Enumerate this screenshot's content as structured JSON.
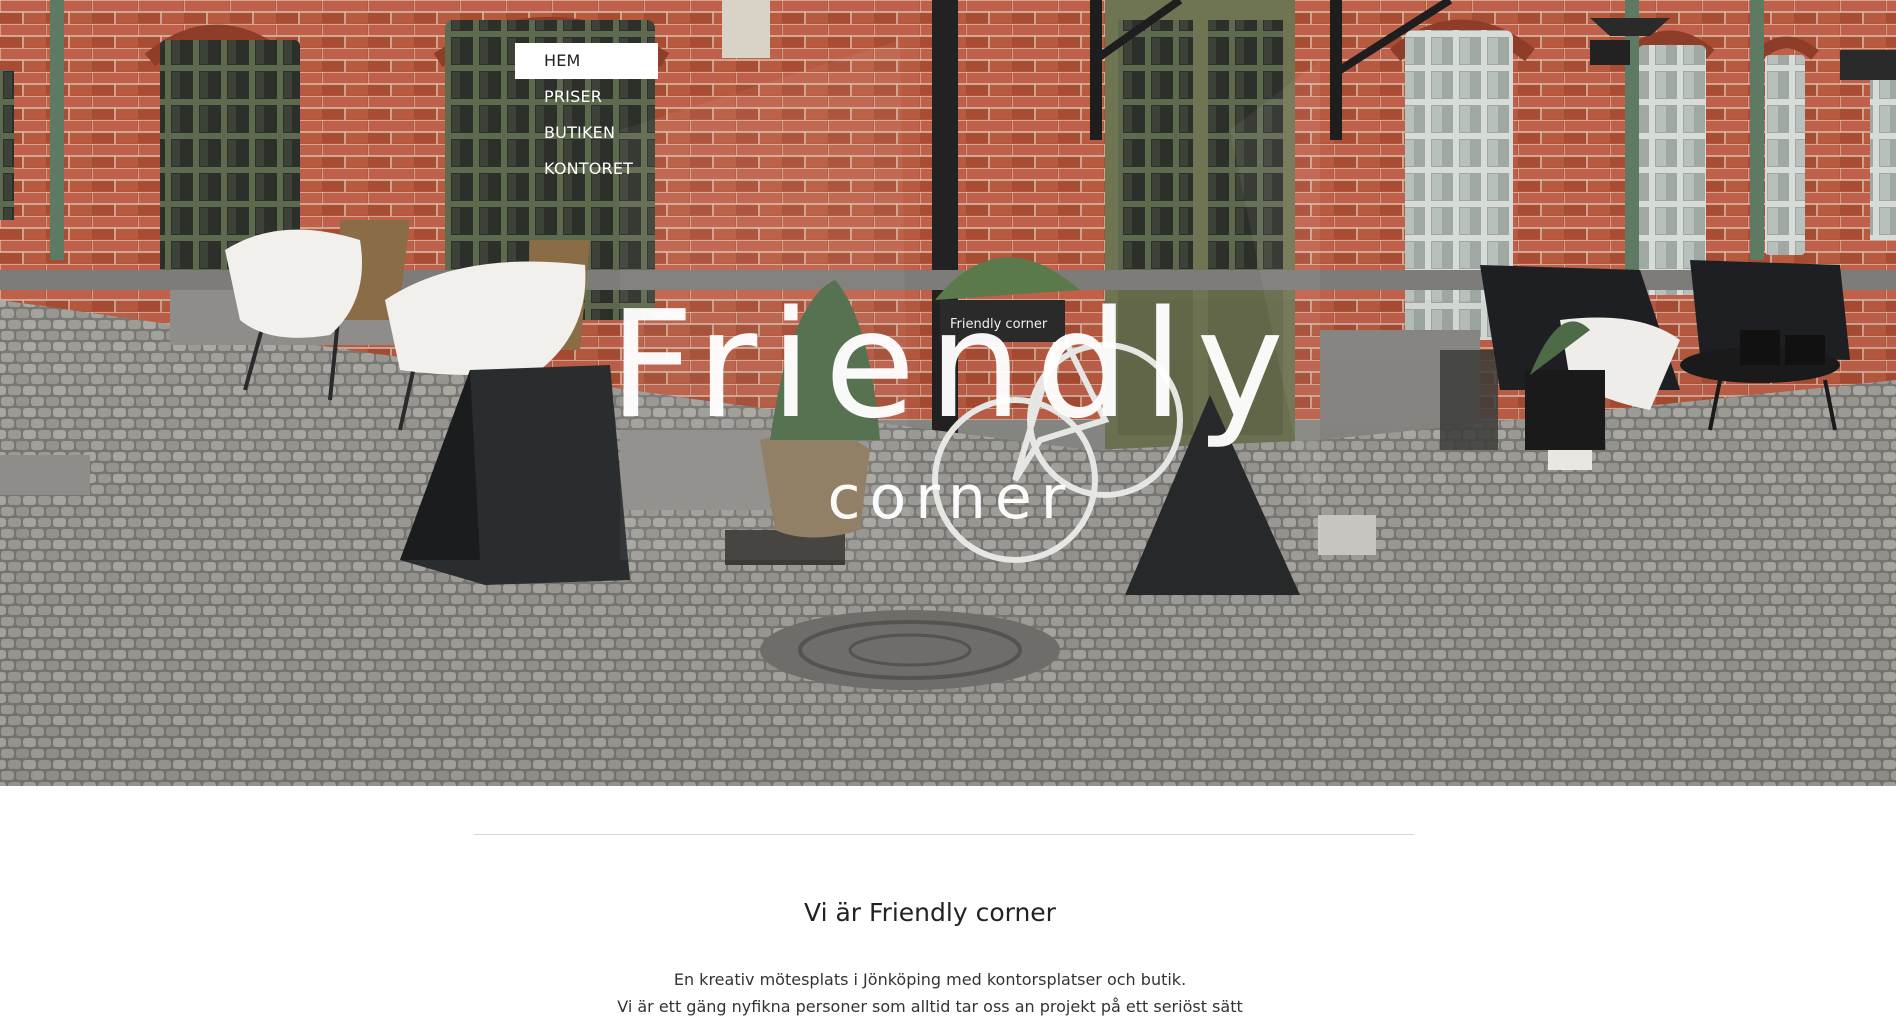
{
  "nav": {
    "items": [
      {
        "label": "HEM",
        "active": true
      },
      {
        "label": "PRISER",
        "active": false
      },
      {
        "label": "BUTIKEN",
        "active": false
      },
      {
        "label": "KONTORET",
        "active": false
      }
    ]
  },
  "hero": {
    "logo_main": "Friendly",
    "logo_sub": "corner",
    "sign_text": "Friendly corner"
  },
  "content": {
    "title": "Vi är Friendly corner",
    "lines": [
      "En kreativ mötesplats i Jönköping med kontorsplatser och butik.",
      "Vi är ett gäng nyfikna personer som alltid tar oss an projekt på ett seriöst sätt"
    ]
  },
  "colors": {
    "brick": "#b5553a",
    "cobblestone": "#9a9893",
    "window_frame": "#5e6a4e",
    "door": "#6f7553",
    "nav_active_bg": "#ffffff",
    "text": "#222222"
  }
}
